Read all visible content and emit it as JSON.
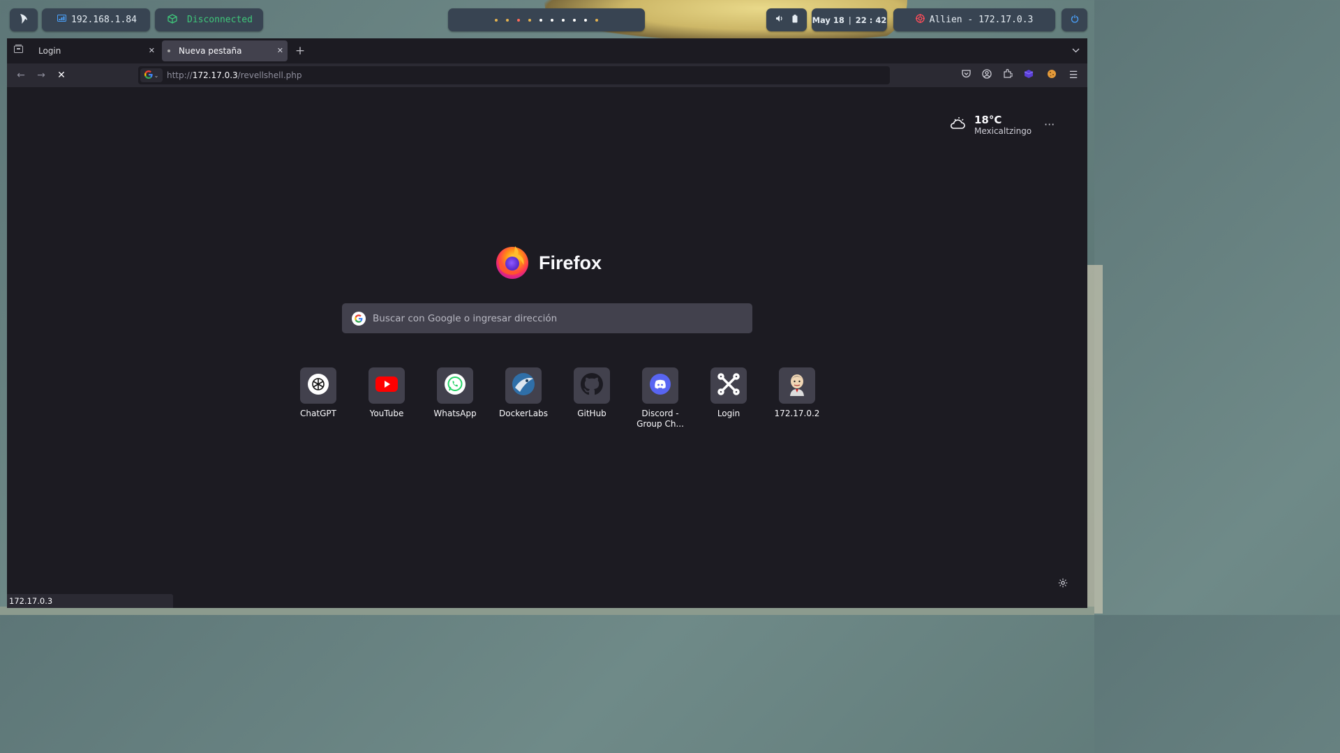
{
  "topbar": {
    "local_ip": "192.168.1.84",
    "vpn_status": "Disconnected",
    "workspace_dot_colors": [
      "#e6b450",
      "#e6b450",
      "#ff6a5a",
      "#e6b450",
      "#ffffff",
      "#ffffff",
      "#ffffff",
      "#ffffff",
      "#ffffff",
      "#e6b450"
    ],
    "date": "May 18",
    "time": "22 : 42",
    "target_label": "Allien - 172.17.0.3",
    "icons": [
      "parrot-logo-icon",
      "network-icon",
      "vpn-cube-icon",
      "volume-icon",
      "battery-icon",
      "target-icon",
      "power-icon"
    ]
  },
  "browser": {
    "tabs": [
      {
        "title": "Login",
        "active": false
      },
      {
        "title": "Nueva pestaña",
        "active": true
      }
    ],
    "url_prefix": "http://",
    "url_host": "172.17.0.3",
    "url_path": "/revellshell.php"
  },
  "newtab": {
    "weather_temp": "18°C",
    "weather_city": "Mexicaltzingo",
    "logo_text": "Firefox",
    "search_placeholder": "Buscar con Google o ingresar dirección",
    "shortcuts": [
      {
        "label": "ChatGPT",
        "icon": "chatgpt-icon"
      },
      {
        "label": "YouTube",
        "icon": "youtube-icon"
      },
      {
        "label": "WhatsApp",
        "icon": "whatsapp-icon"
      },
      {
        "label": "DockerLabs",
        "icon": "dockerlabs-icon"
      },
      {
        "label": "GitHub",
        "icon": "github-icon"
      },
      {
        "label": "Discord - Group Ch...",
        "icon": "discord-icon"
      },
      {
        "label": "Login",
        "icon": "joomla-icon"
      },
      {
        "label": "172.17.0.2",
        "icon": "jenkins-icon"
      }
    ]
  },
  "status_text": "172.17.0.3",
  "colors": {
    "accent": "#4aa3ff",
    "vpn_green": "#3fc77a",
    "target_red": "#ff4d5a"
  }
}
